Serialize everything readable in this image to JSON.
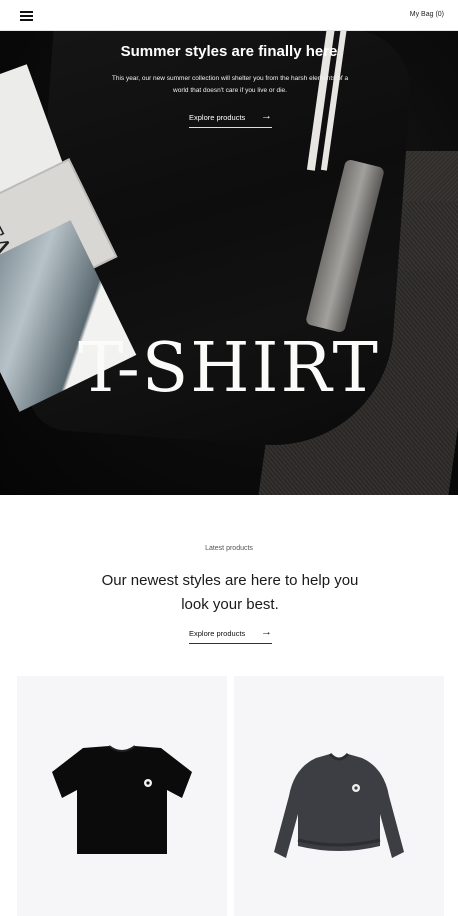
{
  "header": {
    "menu_icon": "hamburger-menu-icon",
    "bag_label": "My Bag (0)"
  },
  "hero": {
    "title": "Summer styles are finally here",
    "subtitle": "This year, our new summer collection will shelter you from the harsh elements of a world that doesn't care if you live or die.",
    "cta_label": "Explore products",
    "cta_icon": "arrow-right-icon",
    "image_text": "T-SHIRT",
    "magazine_text": "FASHI"
  },
  "latest": {
    "label": "Latest products",
    "heading": "Our newest styles are here to help you look your best.",
    "cta_label": "Explore products",
    "cta_icon": "arrow-right-icon"
  },
  "products": [
    {
      "type": "black-tshirt",
      "color": "#0b0b0b"
    },
    {
      "type": "charcoal-sweatshirt",
      "color": "#3c3e44"
    }
  ]
}
